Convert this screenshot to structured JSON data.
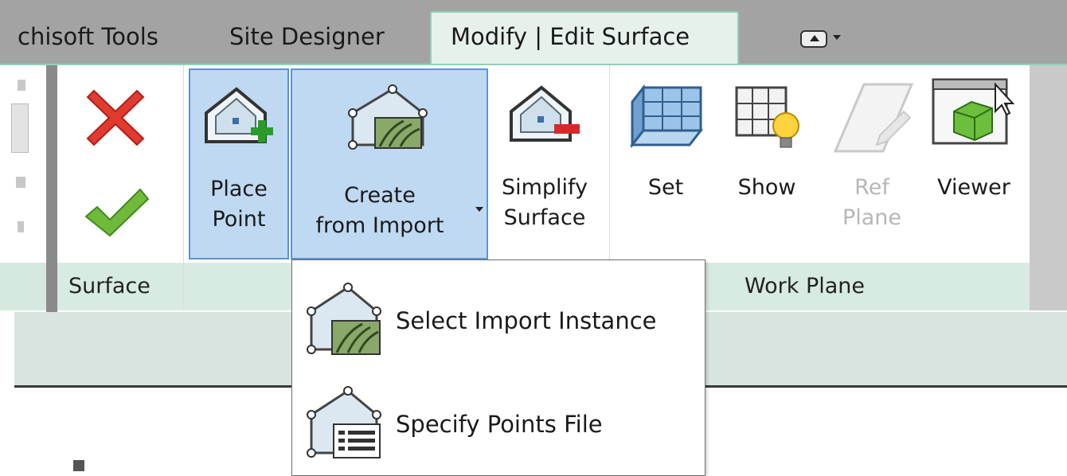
{
  "tabs": [
    {
      "label": "chisoft Tools"
    },
    {
      "label": "Site Designer"
    },
    {
      "label": "Modify | Edit Surface",
      "active": true
    }
  ],
  "ribbon": {
    "surface_panel": {
      "title": "Surface",
      "buttons": [
        {
          "name": "cancel",
          "icon": "red-x-icon"
        },
        {
          "name": "finish",
          "icon": "green-check-icon"
        }
      ]
    },
    "tools": {
      "place_point": {
        "line1": "Place",
        "line2": "Point"
      },
      "create_from_import": {
        "line1": "Create",
        "line2": "from Import"
      },
      "simplify_surface": {
        "line1": "Simplify",
        "line2": "Surface"
      }
    },
    "work_plane_panel": {
      "title": "Work Plane",
      "set": {
        "label": "Set"
      },
      "show": {
        "label": "Show"
      },
      "ref_plane": {
        "line1": "Ref",
        "line2": "Plane",
        "disabled": true
      },
      "viewer": {
        "label": "Viewer"
      }
    }
  },
  "dropdown": {
    "items": [
      {
        "label": "Select Import Instance",
        "icon": "import-instance-icon"
      },
      {
        "label": "Specify Points File",
        "icon": "points-file-icon"
      }
    ]
  },
  "colors": {
    "selected_fill": "#bfd9f2",
    "selected_border": "#5a95d3",
    "cancel_red": "#e03b2f",
    "finish_green": "#58a82c"
  }
}
